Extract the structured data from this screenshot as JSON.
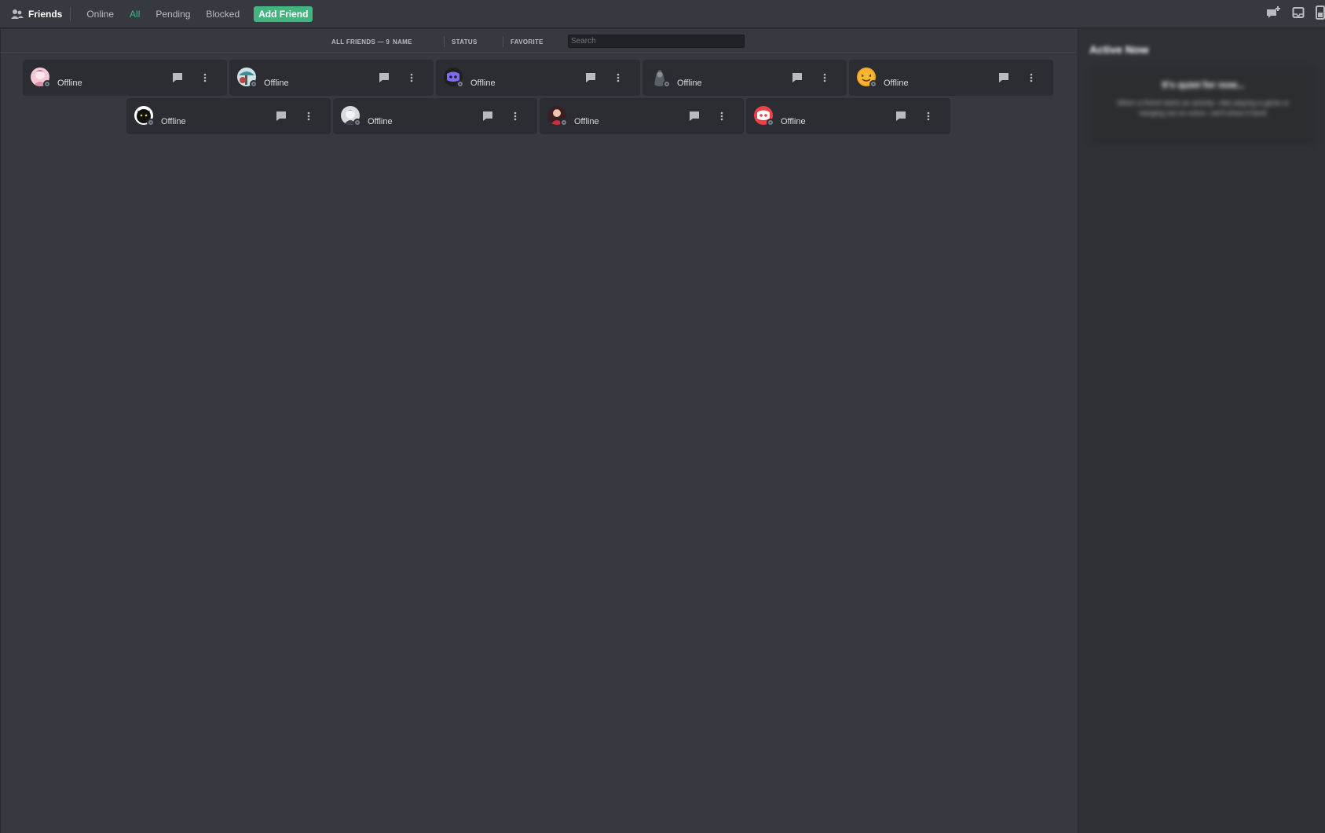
{
  "header": {
    "title": "Friends",
    "tabs": [
      {
        "label": "Online"
      },
      {
        "label": "All"
      },
      {
        "label": "Pending"
      },
      {
        "label": "Blocked"
      }
    ],
    "add_friend_label": "Add Friend",
    "right_icons": [
      "new-group-dm-icon",
      "inbox-icon",
      "help-icon"
    ]
  },
  "columns": {
    "all_friends": "ALL FRIENDS — 9",
    "name": "NAME",
    "status": "STATUS",
    "favorite": "FAVORITE",
    "search_placeholder": "Search"
  },
  "friends": [
    {
      "status": "Offline",
      "avatar": "pink-anime-avatar"
    },
    {
      "status": "Offline",
      "avatar": "teal-character-avatar"
    },
    {
      "status": "Offline",
      "avatar": "discord-blurple-avatar"
    },
    {
      "status": "Offline",
      "avatar": "dark-silhouette-avatar"
    },
    {
      "status": "Offline",
      "avatar": "yellow-emoji-avatar"
    },
    {
      "status": "Offline",
      "avatar": "black-cat-avatar"
    },
    {
      "status": "Offline",
      "avatar": "white-anime-avatar"
    },
    {
      "status": "Offline",
      "avatar": "red-character-avatar"
    },
    {
      "status": "Offline",
      "avatar": "discord-red-avatar"
    }
  ],
  "side_panel": {
    "title": "Active Now",
    "box_title": "It's quiet for now...",
    "box_body": "When a friend starts an activity—like playing a game or hanging out on voice—we'll show it here!"
  },
  "colors": {
    "background": "#36393f",
    "card": "#2b2d32",
    "accent_green": "#43b581",
    "offline_gray": "#747f8d"
  }
}
